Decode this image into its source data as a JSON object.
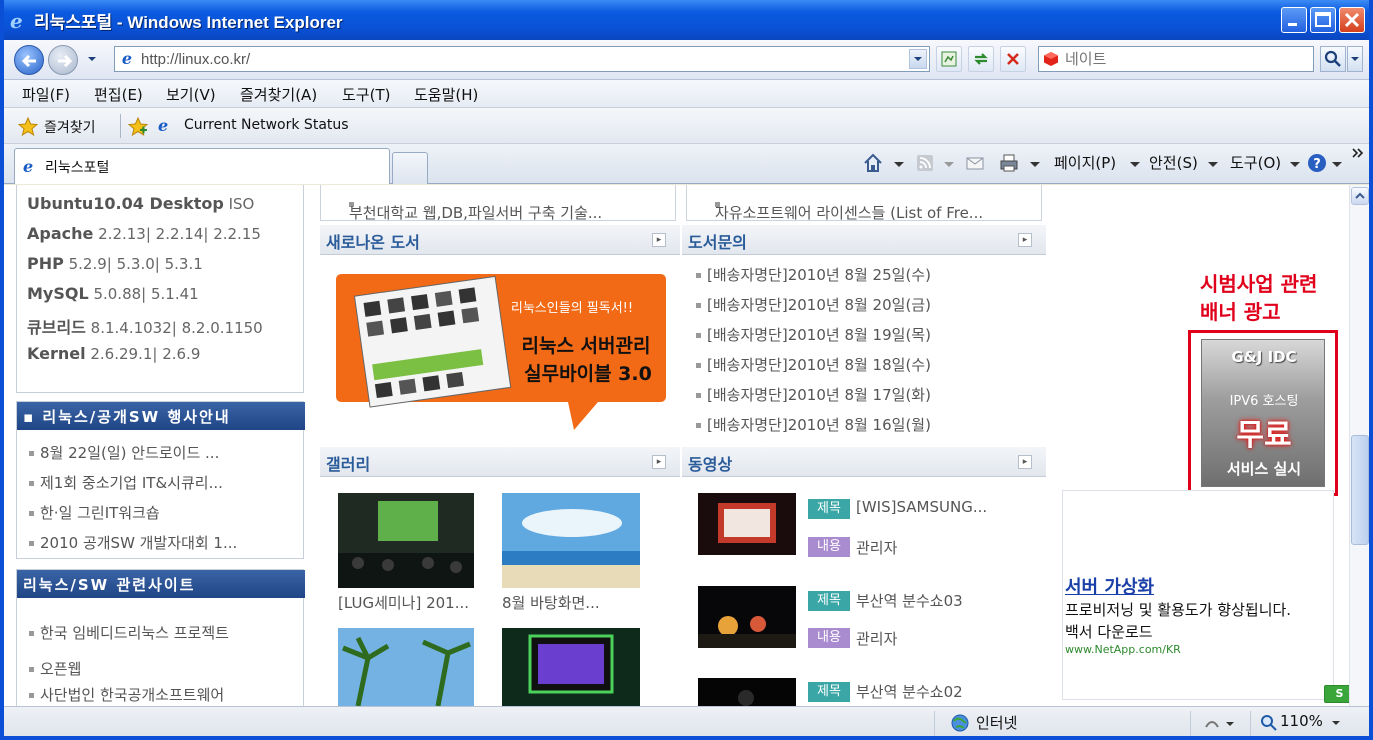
{
  "window": {
    "title": "리눅스포털 - Windows Internet Explorer"
  },
  "address": {
    "url": "http://linux.co.kr/"
  },
  "search": {
    "provider": "네이트"
  },
  "menu": [
    "파일(F)",
    "편집(E)",
    "보기(V)",
    "즐겨찾기(A)",
    "도구(T)",
    "도움말(H)"
  ],
  "favorites": {
    "label": "즐겨찾기",
    "link": "Current Network Status"
  },
  "tab": {
    "label": "리눅스포털"
  },
  "commandbar": {
    "page": "페이지(P)",
    "safety": "안전(S)",
    "tools": "도구(O)"
  },
  "sidebar": {
    "software": [
      {
        "name": "Ubuntu10.04 Desktop",
        "ver": " ISO"
      },
      {
        "name": "Apache",
        "ver": " 2.2.13| 2.2.14| 2.2.15"
      },
      {
        "name": "PHP",
        "ver": " 5.2.9| 5.3.0| 5.3.1"
      },
      {
        "name": "MySQL",
        "ver": " 5.0.88| 5.1.41"
      },
      {
        "name": "큐브리드",
        "ver": " 8.1.4.1032| 8.2.0.1150"
      },
      {
        "name": "Kernel",
        "ver": " 2.6.29.1| 2.6.9"
      }
    ],
    "events_title": "▪ 리눅스/공개SW 행사안내",
    "events": [
      "8월 22일(일) 안드로이드 ...",
      "제1회 중소기업 IT&시큐리...",
      "한·일 그린IT워크숍",
      "2010 공개SW 개발자대회 1..."
    ],
    "sites_title": "리눅스/SW 관련사이트",
    "sites": [
      "한국 임베디드리눅스 프로젝트",
      "오픈웹",
      "사단법인 한국공개소프트웨어"
    ]
  },
  "main": {
    "top_links": [
      "부천대학교 웹,DB,파일서버 구축 기술...",
      "자유소프트웨어 라이센스들 (List of Fre..."
    ],
    "new_books": "새로나온 도서",
    "book_inquiry": "도서문의",
    "book_cover": {
      "tagline": "리눅스인들의 필독서!!",
      "title1": "리눅스 서버관리",
      "title2": "실무바이블 3.0"
    },
    "inquiries": [
      "[배송자명단]2010년 8월 25일(수)",
      "[배송자명단]2010년 8월 20일(금)",
      "[배송자명단]2010년 8월 19일(목)",
      "[배송자명단]2010년 8월 18일(수)",
      "[배송자명단]2010년 8월 17일(화)",
      "[배송자명단]2010년 8월 16일(월)"
    ],
    "gallery": "갤러리",
    "video": "동영상",
    "gallery_items": [
      "[LUG세미나] 201...",
      "8월 바탕화면..."
    ],
    "videos": [
      {
        "title": "[WIS]SAMSUNG...",
        "author": "관리자"
      },
      {
        "title": "부산역 분수쇼03",
        "author": "관리자"
      },
      {
        "title": "부산역 분수쇼02",
        "author": ""
      }
    ],
    "title_tag": "제목",
    "body_tag": "내용"
  },
  "ad": {
    "annotation1": "시범사업 관련",
    "annotation2": "배너 광고",
    "brand": "G&J IDC",
    "sub": "IPV6 호스팅",
    "big": "무료",
    "foot": "서비스 실시"
  },
  "textad": {
    "title": "서버 가상화",
    "line1": "프로비저닝 및 활용도가 향상됩니다.",
    "line2": "백서 다운로드",
    "url": "www.NetApp.com/KR"
  },
  "status": {
    "zone": "인터넷",
    "zoom": "110%"
  }
}
